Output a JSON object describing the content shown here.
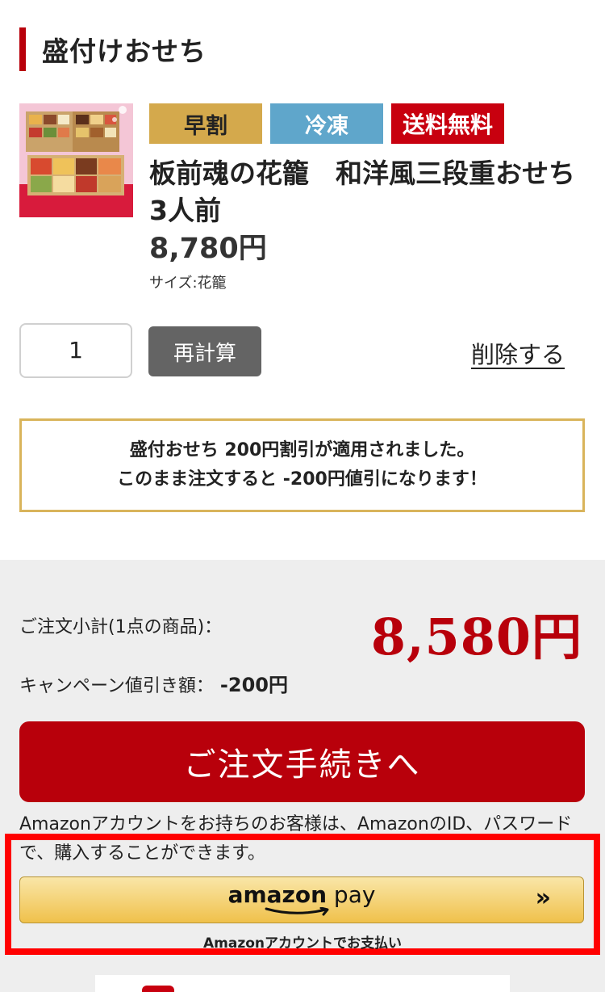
{
  "section": {
    "title": "盛付けおせち"
  },
  "product": {
    "badges": {
      "early": "早割",
      "frozen": "冷凍",
      "free_shipping": "送料無料"
    },
    "name": "板前魂の花籠　和洋風三段重おせち　3人前",
    "price": "8,780円",
    "size": "サイズ:花籠",
    "image_alt": "product-thumbnail"
  },
  "cart": {
    "quantity": "1",
    "recalc_label": "再計算",
    "delete_label": "削除する"
  },
  "notice": {
    "line1": "盛付おせち 200円割引が適用されました。",
    "line2": "このまま注文すると -200円値引になります！"
  },
  "summary": {
    "subtotal_label": "ご注文小計(1点の商品)：",
    "subtotal_value": "8,580円",
    "discount_label": "キャンペーン値引き額：",
    "discount_value": "-200円"
  },
  "checkout": {
    "order_label": "ご注文手続きへ"
  },
  "amazon": {
    "note": "Amazonアカウントをお持ちのお客様は、AmazonのID、パスワードで、購入することができます。",
    "logo_amazon": "amazon",
    "logo_pay": " pay",
    "arrow": "»",
    "sub_label": "Amazonアカウントでお支払い"
  },
  "colors": {
    "accent_red": "#b8000b",
    "gold": "#d4a94c",
    "frozen_blue": "#5fa6cb",
    "highlight": "#ff0000"
  }
}
